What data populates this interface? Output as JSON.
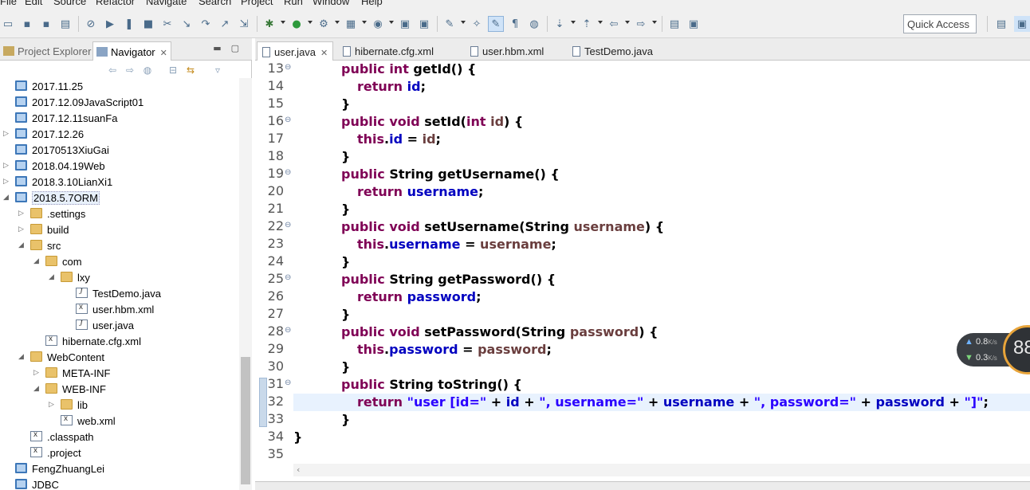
{
  "menu": [
    "File",
    "Edit",
    "Source",
    "Refactor",
    "Navigate",
    "Search",
    "Project",
    "Run",
    "Window",
    "Help"
  ],
  "toolbar": {
    "quick_access_placeholder": "Quick Access",
    "icons": [
      "new-icon",
      "save-icon",
      "save-all-icon",
      "print-icon",
      "skip-breakpoints-icon",
      "resume-icon",
      "suspend-icon",
      "terminate-icon",
      "disconnect-icon",
      "step-into-icon",
      "step-over-icon",
      "step-return-icon",
      "drop-to-frame-icon",
      "debug-icon",
      "run-icon",
      "external-tools-icon",
      "new-server-icon",
      "new-class-icon",
      "open-type-icon",
      "open-task-icon",
      "search-icon",
      "toggle-mark-occurrences-icon",
      "toggle-highlight-icon",
      "show-whitespace-icon",
      "globe-icon",
      "next-annotation-icon",
      "previous-annotation-icon",
      "back-icon",
      "forward-icon",
      "open-perspective-icon",
      "java-perspective-icon"
    ]
  },
  "left_panel": {
    "tabs": [
      {
        "label": "Project Explorer",
        "icon": "project-explorer-icon",
        "active": false
      },
      {
        "label": "Navigator",
        "icon": "navigator-icon",
        "active": true
      }
    ],
    "close_glyph": "✕",
    "view_controls": [
      "minimize-icon",
      "maximize-icon"
    ],
    "nav_toolbar_icons": [
      "back-icon",
      "forward-icon",
      "up-icon",
      "collapse-all-icon",
      "link-editor-icon",
      "view-menu-icon"
    ],
    "tree": [
      {
        "label": "2017.11.25",
        "depth": 0,
        "icon": "project",
        "expander": ""
      },
      {
        "label": "2017.12.09JavaScript01",
        "depth": 0,
        "icon": "project",
        "expander": ""
      },
      {
        "label": "2017.12.11suanFa",
        "depth": 0,
        "icon": "project",
        "expander": ""
      },
      {
        "label": "2017.12.26",
        "depth": 0,
        "icon": "project",
        "expander": "▷"
      },
      {
        "label": "20170513XiuGai",
        "depth": 0,
        "icon": "project",
        "expander": ""
      },
      {
        "label": "2018.04.19Web",
        "depth": 0,
        "icon": "project",
        "expander": "▷"
      },
      {
        "label": "2018.3.10LianXi1",
        "depth": 0,
        "icon": "project",
        "expander": "▷"
      },
      {
        "label": "2018.5.7ORM",
        "depth": 0,
        "icon": "project",
        "expander": "◢",
        "selected": true
      },
      {
        "label": ".settings",
        "depth": 1,
        "icon": "folder",
        "expander": "▷"
      },
      {
        "label": "build",
        "depth": 1,
        "icon": "folder",
        "expander": "▷"
      },
      {
        "label": "src",
        "depth": 1,
        "icon": "folder",
        "expander": "◢"
      },
      {
        "label": "com",
        "depth": 2,
        "icon": "folder",
        "expander": "◢"
      },
      {
        "label": "lxy",
        "depth": 3,
        "icon": "folder",
        "expander": "◢"
      },
      {
        "label": "TestDemo.java",
        "depth": 4,
        "icon": "java",
        "expander": ""
      },
      {
        "label": "user.hbm.xml",
        "depth": 4,
        "icon": "xml",
        "expander": ""
      },
      {
        "label": "user.java",
        "depth": 4,
        "icon": "java",
        "expander": ""
      },
      {
        "label": "hibernate.cfg.xml",
        "depth": 2,
        "icon": "xml",
        "expander": ""
      },
      {
        "label": "WebContent",
        "depth": 1,
        "icon": "folder",
        "expander": "◢"
      },
      {
        "label": "META-INF",
        "depth": 2,
        "icon": "folder",
        "expander": "▷"
      },
      {
        "label": "WEB-INF",
        "depth": 2,
        "icon": "folder",
        "expander": "◢"
      },
      {
        "label": "lib",
        "depth": 3,
        "icon": "folder",
        "expander": "▷"
      },
      {
        "label": "web.xml",
        "depth": 3,
        "icon": "xml",
        "expander": ""
      },
      {
        "label": ".classpath",
        "depth": 1,
        "icon": "xml",
        "expander": ""
      },
      {
        "label": ".project",
        "depth": 1,
        "icon": "xml",
        "expander": ""
      },
      {
        "label": "FengZhuangLei",
        "depth": 0,
        "icon": "project",
        "expander": ""
      },
      {
        "label": "JDBC",
        "depth": 0,
        "icon": "project",
        "expander": ""
      }
    ]
  },
  "editor": {
    "tabs": [
      {
        "label": "user.java",
        "active": true
      },
      {
        "label": "hibernate.cfg.xml",
        "active": false
      },
      {
        "label": "user.hbm.xml",
        "active": false
      },
      {
        "label": "TestDemo.java",
        "active": false
      }
    ],
    "close_glyph": "✕",
    "current_line": 32,
    "lines": [
      {
        "n": 13,
        "fold": "⊖",
        "indent": 1,
        "tokens": [
          [
            "kw",
            "public int "
          ],
          [
            "plain",
            "getId() {"
          ]
        ]
      },
      {
        "n": 14,
        "fold": "",
        "indent": 2,
        "tokens": [
          [
            "kw",
            "return "
          ],
          [
            "fld",
            "id"
          ],
          [
            "plain",
            ";"
          ]
        ]
      },
      {
        "n": 15,
        "fold": "",
        "indent": 1,
        "tokens": [
          [
            "plain",
            "}"
          ]
        ]
      },
      {
        "n": 16,
        "fold": "⊖",
        "indent": 1,
        "tokens": [
          [
            "kw",
            "public void "
          ],
          [
            "plain",
            "setId("
          ],
          [
            "kw",
            "int "
          ],
          [
            "prm",
            "id"
          ],
          [
            "plain",
            ") {"
          ]
        ]
      },
      {
        "n": 17,
        "fold": "",
        "indent": 2,
        "tokens": [
          [
            "kw",
            "this"
          ],
          [
            "plain",
            "."
          ],
          [
            "fld",
            "id"
          ],
          [
            "plain",
            " = "
          ],
          [
            "prm",
            "id"
          ],
          [
            "plain",
            ";"
          ]
        ]
      },
      {
        "n": 18,
        "fold": "",
        "indent": 1,
        "tokens": [
          [
            "plain",
            "}"
          ]
        ]
      },
      {
        "n": 19,
        "fold": "⊖",
        "indent": 1,
        "tokens": [
          [
            "kw",
            "public "
          ],
          [
            "plain",
            "String getUsername() {"
          ]
        ]
      },
      {
        "n": 20,
        "fold": "",
        "indent": 2,
        "tokens": [
          [
            "kw",
            "return "
          ],
          [
            "fld",
            "username"
          ],
          [
            "plain",
            ";"
          ]
        ]
      },
      {
        "n": 21,
        "fold": "",
        "indent": 1,
        "tokens": [
          [
            "plain",
            "}"
          ]
        ]
      },
      {
        "n": 22,
        "fold": "⊖",
        "indent": 1,
        "tokens": [
          [
            "kw",
            "public void "
          ],
          [
            "plain",
            "setUsername(String "
          ],
          [
            "prm",
            "username"
          ],
          [
            "plain",
            ") {"
          ]
        ]
      },
      {
        "n": 23,
        "fold": "",
        "indent": 2,
        "tokens": [
          [
            "kw",
            "this"
          ],
          [
            "plain",
            "."
          ],
          [
            "fld",
            "username"
          ],
          [
            "plain",
            " = "
          ],
          [
            "prm",
            "username"
          ],
          [
            "plain",
            ";"
          ]
        ]
      },
      {
        "n": 24,
        "fold": "",
        "indent": 1,
        "tokens": [
          [
            "plain",
            "}"
          ]
        ]
      },
      {
        "n": 25,
        "fold": "⊖",
        "indent": 1,
        "tokens": [
          [
            "kw",
            "public "
          ],
          [
            "plain",
            "String getPassword() {"
          ]
        ]
      },
      {
        "n": 26,
        "fold": "",
        "indent": 2,
        "tokens": [
          [
            "kw",
            "return "
          ],
          [
            "fld",
            "password"
          ],
          [
            "plain",
            ";"
          ]
        ]
      },
      {
        "n": 27,
        "fold": "",
        "indent": 1,
        "tokens": [
          [
            "plain",
            "}"
          ]
        ]
      },
      {
        "n": 28,
        "fold": "⊖",
        "indent": 1,
        "tokens": [
          [
            "kw",
            "public void "
          ],
          [
            "plain",
            "setPassword(String "
          ],
          [
            "prm",
            "password"
          ],
          [
            "plain",
            ") {"
          ]
        ]
      },
      {
        "n": 29,
        "fold": "",
        "indent": 2,
        "tokens": [
          [
            "kw",
            "this"
          ],
          [
            "plain",
            "."
          ],
          [
            "fld",
            "password"
          ],
          [
            "plain",
            " = "
          ],
          [
            "prm",
            "password"
          ],
          [
            "plain",
            ";"
          ]
        ]
      },
      {
        "n": 30,
        "fold": "",
        "indent": 1,
        "tokens": [
          [
            "plain",
            "}"
          ]
        ]
      },
      {
        "n": 31,
        "fold": "⊖",
        "indent": 1,
        "tokens": [
          [
            "kw",
            "public "
          ],
          [
            "plain",
            "String toString() {"
          ]
        ]
      },
      {
        "n": 32,
        "fold": "",
        "indent": 2,
        "tokens": [
          [
            "kw",
            "return "
          ],
          [
            "str",
            "\"user [id=\""
          ],
          [
            "plain",
            " + "
          ],
          [
            "fld",
            "id"
          ],
          [
            "plain",
            " + "
          ],
          [
            "str",
            "\", username=\""
          ],
          [
            "plain",
            " + "
          ],
          [
            "fld",
            "username"
          ],
          [
            "plain",
            " + "
          ],
          [
            "str",
            "\", password=\""
          ],
          [
            "plain",
            " + "
          ],
          [
            "fld",
            "password"
          ],
          [
            "plain",
            " + "
          ],
          [
            "str",
            "\"]\""
          ],
          [
            "plain",
            ";"
          ]
        ]
      },
      {
        "n": 33,
        "fold": "",
        "indent": 1,
        "tokens": [
          [
            "plain",
            "}"
          ]
        ]
      },
      {
        "n": 34,
        "fold": "",
        "indent": 0,
        "tokens": [
          [
            "plain",
            "}"
          ]
        ]
      },
      {
        "n": 35,
        "fold": "",
        "indent": 0,
        "tokens": []
      }
    ]
  },
  "net_widget": {
    "up_speed": "0.8",
    "down_speed": "0.3",
    "unit": "K/s",
    "gauge_value": "88"
  },
  "colors": {
    "keyword": "#7f0055",
    "field": "#0000c0",
    "parameter": "#6a3e3e",
    "string": "#2a00ff",
    "current_line": "#e8f2fe"
  }
}
